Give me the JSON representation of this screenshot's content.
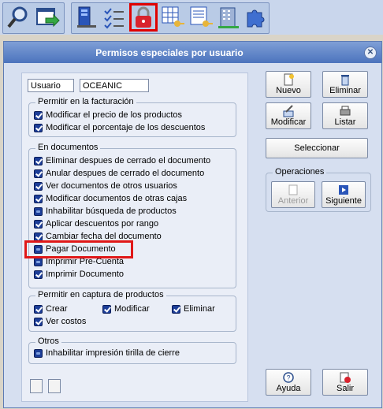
{
  "toolbar": {
    "buttons": [
      {
        "name": "search-icon"
      },
      {
        "name": "export-form-icon"
      },
      {
        "name": "user-list-icon"
      },
      {
        "name": "checklist-icon"
      },
      {
        "name": "lock-permissions-icon",
        "highlighted": true
      },
      {
        "name": "grid-key-icon"
      },
      {
        "name": "document-key-icon"
      },
      {
        "name": "building-icon"
      },
      {
        "name": "puzzle-icon"
      }
    ]
  },
  "window": {
    "title": "Permisos especiales por usuario"
  },
  "user": {
    "label": "Usuario",
    "value": "OCEANIC"
  },
  "facturacion": {
    "title": "Permitir en la facturación",
    "items": [
      {
        "label": "Modificar el precio de los productos",
        "checked": true
      },
      {
        "label": "Modificar el porcentaje de los descuentos",
        "checked": true
      }
    ]
  },
  "documentos": {
    "title": "En documentos",
    "items": [
      {
        "label": "Eliminar despues de cerrado el documento",
        "checked": true
      },
      {
        "label": "Anular despues de cerrado el documento",
        "checked": true
      },
      {
        "label": "Ver documentos de otros usuarios",
        "checked": true
      },
      {
        "label": "Modificar documentos de otras cajas",
        "checked": true
      },
      {
        "label": "Inhabilitar búsqueda de productos",
        "checked": false
      },
      {
        "label": "Aplicar descuentos por rango",
        "checked": true
      },
      {
        "label": "Cambiar fecha del documento",
        "checked": true
      },
      {
        "label": "Pagar Documento",
        "checked": false,
        "highlighted": true
      },
      {
        "label": "Imprimir Pre-Cuenta",
        "checked": false
      },
      {
        "label": "Imprimir Documento",
        "checked": true
      }
    ]
  },
  "captura": {
    "title": "Permitir en captura de productos",
    "items": [
      {
        "label": "Crear",
        "checked": true
      },
      {
        "label": "Modificar",
        "checked": true
      },
      {
        "label": "Eliminar",
        "checked": true
      },
      {
        "label": "Ver costos",
        "checked": true
      }
    ]
  },
  "otros": {
    "title": "Otros",
    "items": [
      {
        "label": "Inhabilitar impresión tirilla de cierre",
        "checked": false
      }
    ]
  },
  "buttons": {
    "nuevo": "Nuevo",
    "eliminar": "Eliminar",
    "modificar": "Modificar",
    "listar": "Listar",
    "seleccionar": "Seleccionar",
    "ayuda": "Ayuda",
    "salir": "Salir"
  },
  "operaciones": {
    "title": "Operaciones",
    "anterior": "Anterior",
    "siguiente": "Siguiente"
  },
  "colors": {
    "highlight": "#e01818",
    "checkbox": "#1d3e98",
    "title_bar": "#4b73bd"
  }
}
